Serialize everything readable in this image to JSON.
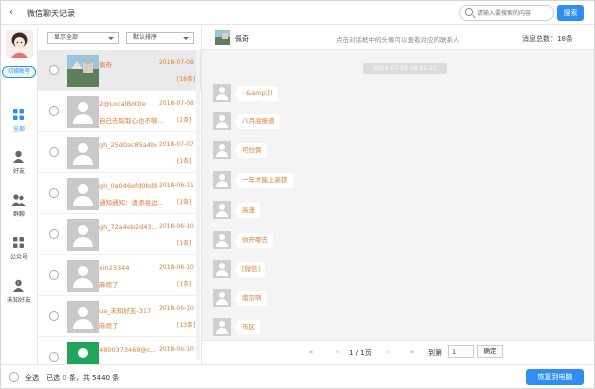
{
  "window": {
    "title": "微信聊天记录",
    "back_glyph": "‹"
  },
  "search": {
    "placeholder": "请输入要搜索的内容",
    "button": "搜索"
  },
  "leftnav": {
    "switch_account": "切换账号",
    "items": [
      {
        "label": "全部",
        "icon": "grid-icon",
        "active": true
      },
      {
        "label": "好友",
        "icon": "person-icon",
        "active": false
      },
      {
        "label": "群聊",
        "icon": "group-icon",
        "active": false
      },
      {
        "label": "公众号",
        "icon": "apps-icon",
        "active": false
      },
      {
        "label": "未知好友",
        "icon": "unknown-user-icon",
        "active": false
      }
    ]
  },
  "filters": {
    "show": "显示全部",
    "sort": "默认排序"
  },
  "contacts": [
    {
      "name": "佩奇",
      "date": "2018-07-08",
      "snippet": "",
      "count": "[18条]",
      "pic": "photo",
      "selected": true
    },
    {
      "name": "2@LocalBottle",
      "date": "2018-07-08",
      "snippet": "自己去取取心也不够...",
      "count": "[1条]",
      "pic": "default"
    },
    {
      "name": "gh_25d0ac85a4bc",
      "date": "2018-07-07",
      "snippet": "",
      "count": "[1条]",
      "pic": "default"
    },
    {
      "name": "gh_0a046efd0bd8",
      "date": "2018-06-11",
      "snippet": "通知通知：请添易边...",
      "count": "[1条]",
      "pic": "default"
    },
    {
      "name": "gh_72a4eb2d43...",
      "date": "2018-06-10",
      "snippet": "",
      "count": "[1条]",
      "pic": "default"
    },
    {
      "name": "xin23344",
      "date": "2018-06-10",
      "snippet": "麻烦了",
      "count": "[1条]",
      "pic": "default"
    },
    {
      "name": "ua_未知好友-317",
      "date": "2018-06-10",
      "snippet": "麻烦了",
      "count": "[13条]",
      "pic": "default"
    },
    {
      "name": "4800373469@c...",
      "date": "2018-06-10",
      "snippet": "",
      "count": "",
      "pic": "green"
    }
  ],
  "chat": {
    "name": "佩奇",
    "hint": "点击对话框中的头像可以查看对应的联系人",
    "total": "消息总数：18条",
    "time": "2018-07-03 16:11:21",
    "messages": [
      "· &amp;[(",
      "八月底报道",
      "可拉倒",
      "一年才能上高铁",
      "高速",
      "你开哪去",
      "[微信]",
      "南京啊",
      "市区"
    ]
  },
  "pager": {
    "info": "1 / 1页",
    "goto": "到第",
    "page_value": "1",
    "go_button": "确定"
  },
  "footer": {
    "select_all": "全选",
    "selected_prefix": "已选",
    "selected_count": "0",
    "selected_mid": "条，共",
    "total_count": "5440",
    "selected_suffix": "条",
    "restore_button": "恢复到电脑"
  },
  "colors": {
    "accent": "#2e8ff0",
    "highlight_text": "#e07b3a"
  }
}
